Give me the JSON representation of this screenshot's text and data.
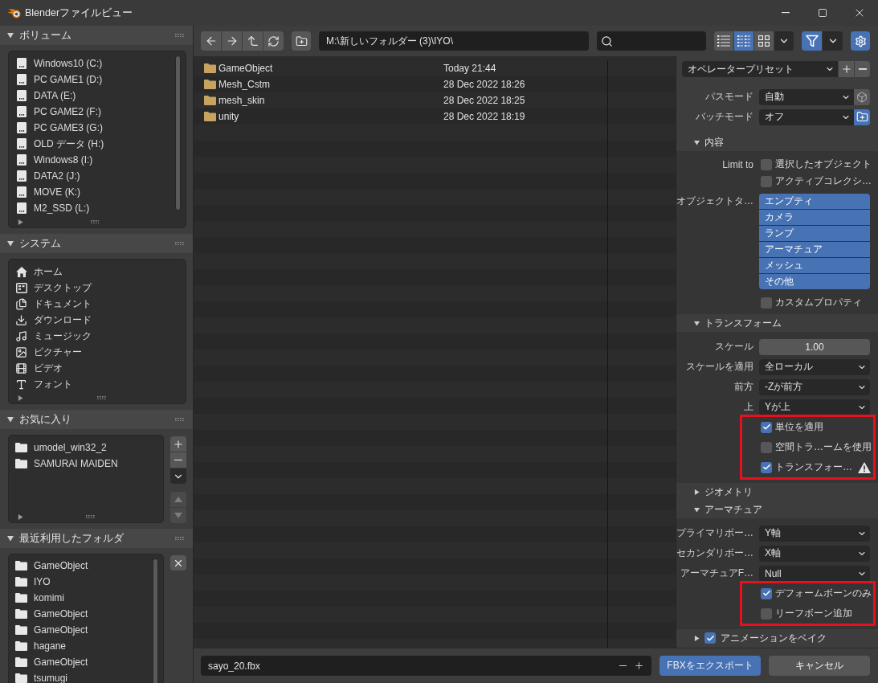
{
  "window": {
    "title": "Blenderファイルビュー"
  },
  "sidebar": {
    "sections": [
      {
        "kind": "volumes",
        "title": "ボリューム",
        "expanded": true,
        "items": [
          {
            "label": "Windows10 (C:)"
          },
          {
            "label": "PC GAME1 (D:)"
          },
          {
            "label": "DATA (E:)"
          },
          {
            "label": "PC GAME2 (F:)"
          },
          {
            "label": "PC GAME3 (G:)"
          },
          {
            "label": "OLD データ (H:)"
          },
          {
            "label": "Windows8 (I:)"
          },
          {
            "label": "DATA2 (J:)"
          },
          {
            "label": "MOVE (K:)"
          },
          {
            "label": "M2_SSD (L:)"
          }
        ]
      },
      {
        "kind": "system",
        "title": "システム",
        "expanded": true,
        "items": [
          {
            "label": "ホーム",
            "kind": "home"
          },
          {
            "label": "デスクトップ",
            "kind": "desktop"
          },
          {
            "label": "ドキュメント",
            "kind": "documents"
          },
          {
            "label": "ダウンロード",
            "kind": "downloads"
          },
          {
            "label": "ミュージック",
            "kind": "music"
          },
          {
            "label": "ピクチャー",
            "kind": "pictures"
          },
          {
            "label": "ビデオ",
            "kind": "videos"
          },
          {
            "label": "フォント",
            "kind": "fonts"
          }
        ]
      },
      {
        "kind": "bookmarks",
        "title": "お気に入り",
        "expanded": true,
        "items": [
          {
            "label": "umodel_win32_2"
          },
          {
            "label": "SAMURAI MAIDEN"
          }
        ],
        "side_buttons": [
          {
            "kind": "add",
            "disabled": false
          },
          {
            "kind": "remove",
            "disabled": false
          },
          {
            "kind": "menu",
            "disabled": false
          },
          {
            "kind": "move_up",
            "disabled": true
          },
          {
            "kind": "move_down",
            "disabled": true
          }
        ]
      },
      {
        "kind": "recent",
        "title": "最近利用したフォルダ",
        "expanded": true,
        "items": [
          {
            "label": "GameObject"
          },
          {
            "label": "IYO"
          },
          {
            "label": "komimi"
          },
          {
            "label": "GameObject"
          },
          {
            "label": "GameObject"
          },
          {
            "label": "hagane"
          },
          {
            "label": "GameObject"
          },
          {
            "label": "tsumugi"
          }
        ],
        "side_buttons": [
          {
            "kind": "clear",
            "disabled": false
          }
        ]
      }
    ]
  },
  "toolbar": {
    "path": "M:\\新しいフォルダー (3)\\IYO\\",
    "display_modes": [
      {
        "kind": "vertical_list",
        "selected": false
      },
      {
        "kind": "horizontal_list",
        "selected": true
      },
      {
        "kind": "thumbnails",
        "selected": false
      }
    ],
    "filter": {
      "on": true
    },
    "settings": {
      "on": true
    }
  },
  "files": {
    "rows": [
      {
        "name": "GameObject",
        "date": "Today 21:44"
      },
      {
        "name": "Mesh_Cstm",
        "date": "28 Dec 2022 18:26"
      },
      {
        "name": "mesh_skin",
        "date": "28 Dec 2022 18:25"
      },
      {
        "name": "unity",
        "date": "28 Dec 2022 18:19"
      }
    ]
  },
  "properties": {
    "preset": "オペレータープリセット",
    "fields": [
      {
        "label": "パスモード",
        "value": "自動",
        "toggle": {
          "kind": "cube",
          "on": false
        }
      },
      {
        "label": "バッチモード",
        "value": "オフ",
        "toggle": {
          "kind": "folder",
          "on": true
        }
      }
    ],
    "sections": [
      {
        "title": "内容",
        "expanded": true,
        "rows": [
          {
            "kind": "checkbox",
            "label": "Limit to",
            "text": "選択したオブジェクト",
            "checked": false
          },
          {
            "kind": "checkbox",
            "text": "アクティブコレクシ…",
            "checked": false
          },
          {
            "kind": "toggles",
            "label": "オブジェクトタ…",
            "options": [
              {
                "text": "エンプティ",
                "selected": true
              },
              {
                "text": "カメラ",
                "selected": true
              },
              {
                "text": "ランプ",
                "selected": true
              },
              {
                "text": "アーマチュア",
                "selected": true
              },
              {
                "text": "メッシュ",
                "selected": true
              },
              {
                "text": "その他",
                "selected": true
              }
            ]
          },
          {
            "kind": "checkbox",
            "text": "カスタムプロパティ",
            "checked": false
          }
        ]
      },
      {
        "title": "トランスフォーム",
        "expanded": true,
        "rows": [
          {
            "kind": "number",
            "label": "スケール",
            "value": "1.00"
          },
          {
            "kind": "select",
            "label": "スケールを適用",
            "value": "全ローカル"
          },
          {
            "kind": "select",
            "label": "前方",
            "value": "-Zが前方"
          },
          {
            "kind": "select",
            "label": "上",
            "value": "Yが上"
          },
          {
            "kind": "group",
            "highlighted": true,
            "rows": [
              {
                "kind": "checkbox",
                "text": "単位を適用",
                "checked": true
              },
              {
                "kind": "checkbox",
                "text": "空間トラ…ームを使用",
                "checked": false
              },
              {
                "kind": "checkbox",
                "text": "トランスフォー…",
                "checked": true,
                "warning": true
              }
            ]
          }
        ]
      },
      {
        "title": "ジオメトリ",
        "expanded": false
      },
      {
        "title": "アーマチュア",
        "expanded": true,
        "rows": [
          {
            "kind": "select",
            "label": "プライマリボー…",
            "value": "Y軸"
          },
          {
            "kind": "select",
            "label": "セカンダリボー…",
            "value": "X軸"
          },
          {
            "kind": "select",
            "label": "アーマチュアF…",
            "value": "Null"
          },
          {
            "kind": "group",
            "highlighted": true,
            "rows": [
              {
                "kind": "checkbox",
                "text": "デフォームボーンのみ",
                "checked": true
              },
              {
                "kind": "checkbox",
                "text": "リーフボーン追加",
                "checked": false
              }
            ]
          }
        ]
      },
      {
        "title": "アニメーションをベイク",
        "expanded": false,
        "checked": true
      }
    ]
  },
  "footer": {
    "filename": "sayo_20.fbx",
    "buttons": [
      {
        "label": "FBXをエクスポート",
        "kind": "export"
      },
      {
        "label": "キャンセル",
        "kind": "cancel"
      }
    ]
  }
}
